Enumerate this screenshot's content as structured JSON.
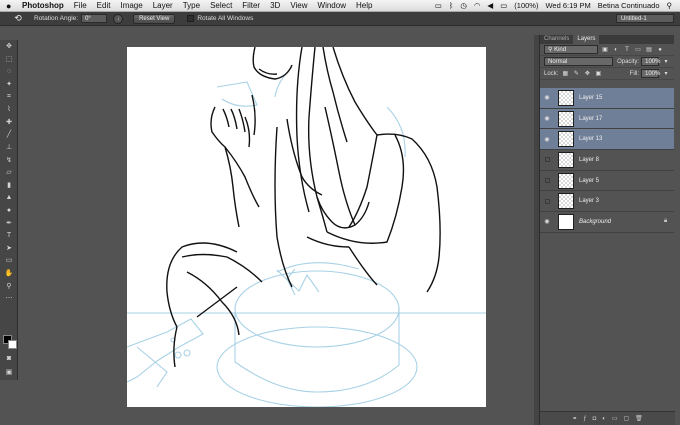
{
  "menubar": {
    "apple": "",
    "app": "Photoshop",
    "items": [
      "File",
      "Edit",
      "Image",
      "Layer",
      "Type",
      "Select",
      "Filter",
      "3D",
      "View",
      "Window",
      "Help"
    ],
    "status_battery": "(100%)",
    "status_clock": "Wed 6:19 PM",
    "status_user": "Betina Continuado",
    "search_icon": "search-icon"
  },
  "options": {
    "rotation_label": "Rotation Angle:",
    "rotation_value": "0°",
    "reset_label": "Reset View",
    "rotate_all_label": "Rotate All Windows",
    "doc_name": "Untitled-1"
  },
  "layers_panel": {
    "tab_channels": "Channels",
    "tab_layers": "Layers",
    "kind_label": "Kind",
    "blend_mode": "Normal",
    "opacity_label": "Opacity:",
    "opacity_value": "100%",
    "lock_label": "Lock:",
    "fill_label": "Fill:",
    "fill_value": "100%",
    "layers": [
      {
        "name": "Layer 15",
        "visible": true,
        "selected": true
      },
      {
        "name": "Layer 17",
        "visible": true,
        "selected": true
      },
      {
        "name": "Layer 13",
        "visible": true,
        "selected": true
      },
      {
        "name": "Layer 8",
        "visible": false,
        "selected": false
      },
      {
        "name": "Layer 5",
        "visible": false,
        "selected": false
      },
      {
        "name": "Layer 3",
        "visible": false,
        "selected": false
      },
      {
        "name": "Background",
        "visible": true,
        "selected": false
      }
    ]
  },
  "colors": {
    "selection": "#6f7f98",
    "sketch_blue": "#a9d2e6"
  }
}
